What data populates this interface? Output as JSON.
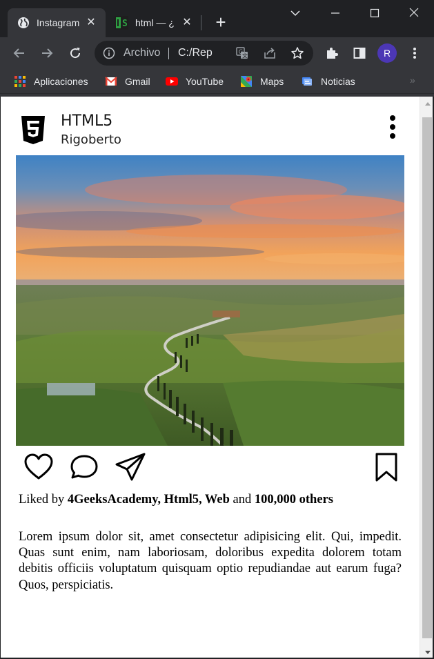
{
  "browser": {
    "tabs": [
      {
        "title": "Instagram",
        "active": true
      },
      {
        "title": "html — ¿",
        "active": false
      }
    ],
    "omnibox": {
      "scheme_label": "Archivo",
      "url": "C:/Rep"
    },
    "avatar_letter": "R",
    "bookmarks": [
      {
        "label": "Aplicaciones",
        "icon": "apps-grid-icon"
      },
      {
        "label": "Gmail",
        "icon": "gmail-icon"
      },
      {
        "label": "YouTube",
        "icon": "youtube-icon"
      },
      {
        "label": "Maps",
        "icon": "maps-icon"
      },
      {
        "label": "Noticias",
        "icon": "news-icon"
      }
    ],
    "bookmarks_overflow": "»",
    "colors": {
      "titlebar": "#202124",
      "toolbar": "#35363a",
      "text": "#e8eaed",
      "avatar": "#4c37b5"
    }
  },
  "post": {
    "title": "HTML5",
    "author": "Rigoberto",
    "photo_description_icon": "landscape-photo",
    "likes": {
      "prefix": "Liked by",
      "names": "4GeeksAcademy, Html5, Web",
      "conjunction": "and",
      "others": "100,000 others"
    },
    "caption": "Lorem ipsum dolor sit, amet consectetur adipisicing elit. Qui, impedit. Quas sunt enim, nam laboriosam, doloribus expedita dolorem totam debitis officiis voluptatum quisquam optio repudiandae aut earum fuga? Quos, perspiciatis."
  }
}
